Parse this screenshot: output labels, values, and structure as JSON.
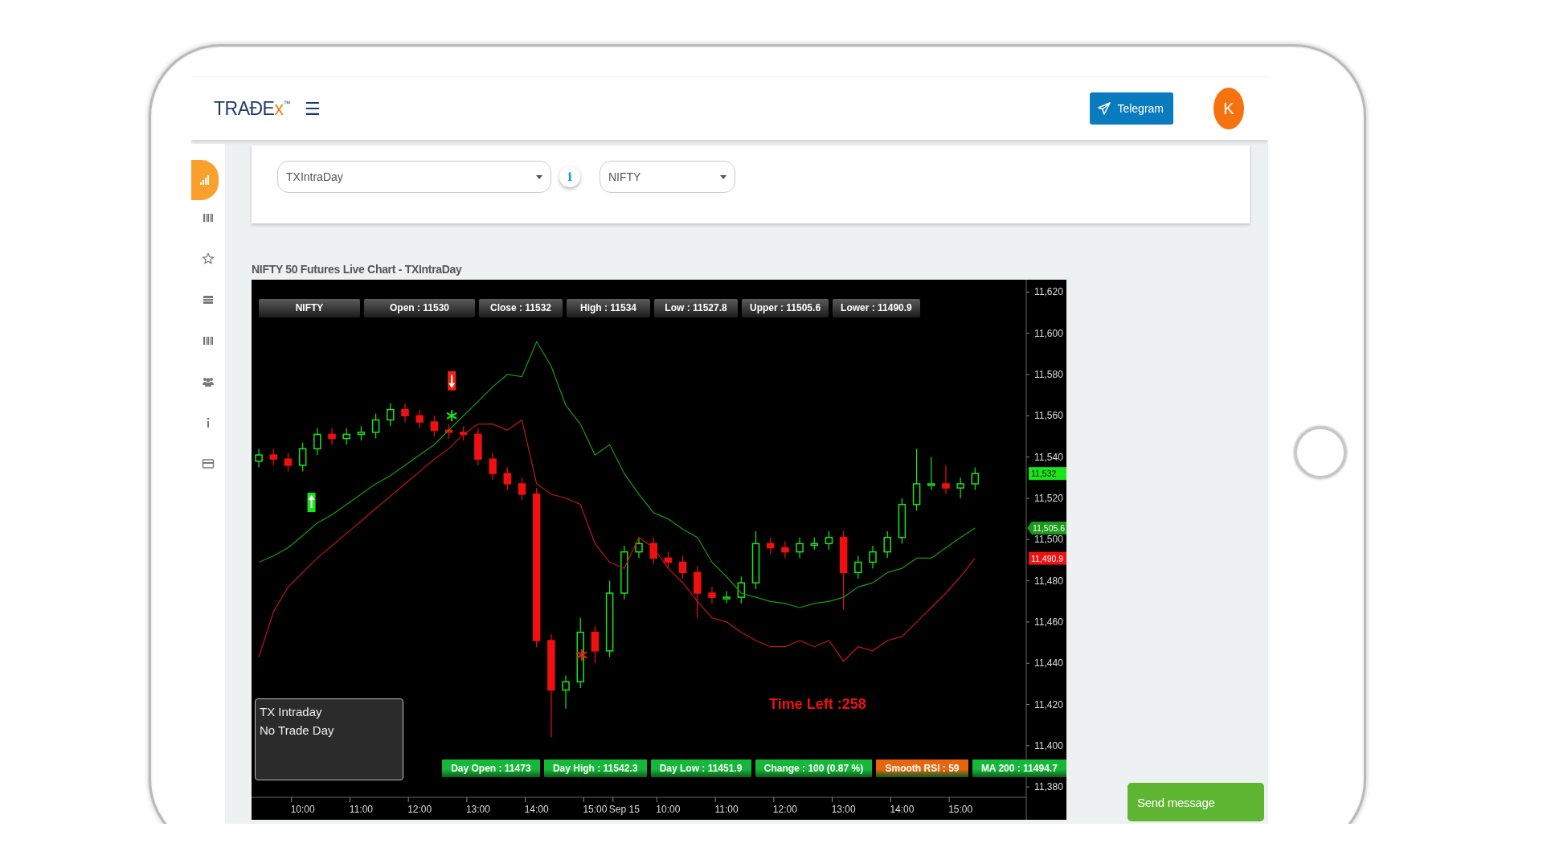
{
  "header": {
    "logo": {
      "text": "TRAĐE",
      "accent": "x",
      "mark": "™"
    },
    "menu_icon": "☰",
    "telegram_button": "Telegram",
    "avatar": "K"
  },
  "sidebar": {
    "items": [
      {
        "selected": true
      },
      {
        "selected": false
      },
      {
        "selected": false
      },
      {
        "selected": false
      },
      {
        "selected": false
      },
      {
        "selected": false
      },
      {
        "selected": false
      },
      {
        "selected": false
      }
    ]
  },
  "filters": {
    "strategy_select": {
      "value": "TXIntraDay"
    },
    "info_button": "i",
    "symbol_select": {
      "value": "NIFTY"
    }
  },
  "chart": {
    "title": "NIFTY 50 Futures Live Chart - TXIntraDay",
    "top_stats": [
      "NIFTY",
      "Open : 11530",
      "Close : 11532",
      "High : 11534",
      "Low : 11527.8",
      "Upper : 11505.6",
      "Lower : 11490.9"
    ],
    "legend": [
      "TX Intraday",
      "No Trade Day"
    ],
    "timer": "Time Left :258",
    "bottom_stats": [
      {
        "label": "Day Open : 11473",
        "color": "#16b83a"
      },
      {
        "label": "Day High : 11542.3",
        "color": "#16b83a"
      },
      {
        "label": "Day Low : 11451.9",
        "color": "#16b83a"
      },
      {
        "label": "Change : 100 (0.87 %)",
        "color": "#16b83a"
      },
      {
        "label": "Smooth RSI : 59",
        "color": "#e8650c"
      },
      {
        "label": "MA 200 : 11494.7",
        "color": "#16b83a"
      }
    ],
    "price_tags": [
      {
        "kind": "close",
        "label": "11,532",
        "color": "#19e619"
      },
      {
        "kind": "upper",
        "label": "11,505.6",
        "color": "#1a9a1a"
      },
      {
        "kind": "lower",
        "label": "11,490.9",
        "color": "#ee1111"
      }
    ],
    "chart_data": {
      "type": "candlestick",
      "ylim": [
        11375,
        11626
      ],
      "categories": [
        null,
        null,
        null,
        "10:00",
        null,
        null,
        null,
        "11:00",
        null,
        null,
        null,
        "12:00",
        null,
        null,
        null,
        "13:00",
        null,
        null,
        null,
        "14:00",
        null,
        null,
        null,
        "15:00",
        null,
        "Sep 15",
        null,
        null,
        "10:00",
        null,
        null,
        null,
        "11:00",
        null,
        null,
        null,
        "12:00",
        null,
        null,
        null,
        "13:00",
        null,
        null,
        null,
        "14:00",
        null,
        null,
        null,
        "15:00",
        null,
        null,
        null,
        null
      ],
      "yticks": [
        {
          "value": 11380,
          "label": "11,380"
        },
        {
          "value": 11400,
          "label": "11,400"
        },
        {
          "value": 11420,
          "label": "11,420"
        },
        {
          "value": 11440,
          "label": "11,440"
        },
        {
          "value": 11460,
          "label": "11,460"
        },
        {
          "value": 11480,
          "label": "11,480"
        },
        {
          "value": 11500,
          "label": "11,500"
        },
        {
          "value": 11520,
          "label": "11,520"
        },
        {
          "value": 11540,
          "label": "11,540"
        },
        {
          "value": 11560,
          "label": "11,560"
        },
        {
          "value": 11580,
          "label": "11,580"
        },
        {
          "value": 11600,
          "label": "11,600"
        },
        {
          "value": 11620,
          "label": "11,620"
        }
      ],
      "ohlc": [
        [
          11538,
          11544,
          11535,
          11541
        ],
        [
          11541,
          11544,
          11536,
          11539
        ],
        [
          11539,
          11542,
          11533,
          11536
        ],
        [
          11536,
          11547,
          11533,
          11544
        ],
        [
          11544,
          11554,
          11541,
          11551
        ],
        [
          11551,
          11554,
          11546,
          11549
        ],
        [
          11549,
          11554,
          11546,
          11551
        ],
        [
          11551,
          11555,
          11548,
          11552
        ],
        [
          11552,
          11561,
          11549,
          11558
        ],
        [
          11558,
          11566,
          11555,
          11563
        ],
        [
          11563,
          11566,
          11557,
          11560
        ],
        [
          11560,
          11563,
          11554,
          11557
        ],
        [
          11557,
          11560,
          11550,
          11553
        ],
        [
          11553,
          11556,
          11549,
          11552
        ],
        [
          11552,
          11555,
          11548,
          11551
        ],
        [
          11551,
          11554,
          11536,
          11539
        ],
        [
          11539,
          11542,
          11529,
          11532
        ],
        [
          11532,
          11535,
          11524,
          11527
        ],
        [
          11527,
          11530,
          11519,
          11522
        ],
        [
          11522,
          11525,
          11448,
          11451
        ],
        [
          11451,
          11454,
          11404,
          11427
        ],
        [
          11427,
          11434,
          11418,
          11431
        ],
        [
          11431,
          11462,
          11428,
          11455
        ],
        [
          11455,
          11458,
          11440,
          11446
        ],
        [
          11446,
          11480,
          11443,
          11474
        ],
        [
          11474,
          11497,
          11471,
          11494
        ],
        [
          11494,
          11501,
          11491,
          11498
        ],
        [
          11498,
          11501,
          11488,
          11491
        ],
        [
          11491,
          11494,
          11486,
          11489
        ],
        [
          11489,
          11492,
          11481,
          11484
        ],
        [
          11484,
          11487,
          11462,
          11474
        ],
        [
          11474,
          11477,
          11469,
          11472
        ],
        [
          11472,
          11475,
          11469,
          11472
        ],
        [
          11472,
          11482,
          11469,
          11479
        ],
        [
          11479,
          11504,
          11476,
          11498
        ],
        [
          11498,
          11501,
          11493,
          11496
        ],
        [
          11496,
          11499,
          11491,
          11494
        ],
        [
          11494,
          11501,
          11491,
          11498
        ],
        [
          11498,
          11501,
          11495,
          11498
        ],
        [
          11498,
          11504,
          11495,
          11501
        ],
        [
          11501,
          11504,
          11466,
          11484
        ],
        [
          11484,
          11492,
          11481,
          11489
        ],
        [
          11489,
          11497,
          11486,
          11494
        ],
        [
          11494,
          11504,
          11491,
          11501
        ],
        [
          11501,
          11520,
          11498,
          11517
        ],
        [
          11517,
          11544,
          11514,
          11527
        ],
        [
          11527,
          11540,
          11524,
          11527
        ],
        [
          11527,
          11536,
          11522,
          11525
        ],
        [
          11525,
          11530,
          11520,
          11527
        ],
        [
          11527,
          11535,
          11524,
          11532
        ],
        null,
        null,
        null
      ],
      "series": [
        {
          "type": "line",
          "color": "#1a9a1a",
          "values": [
            11489,
            11492,
            11496,
            11502,
            11508,
            11512,
            11517,
            11522,
            11527,
            11531,
            11536,
            11541,
            11546,
            11553,
            11560,
            11567,
            11574,
            11580,
            11579,
            11596,
            11584,
            11565,
            11556,
            11541,
            11546,
            11532,
            11522,
            11513,
            11510,
            11505,
            11501,
            11489,
            11482,
            11474,
            11472,
            11470,
            11469,
            11467,
            11469,
            11470,
            11472,
            11477,
            11479,
            11484,
            11486,
            11491,
            11491,
            11496,
            11501,
            11505.6,
            null,
            null,
            null
          ]
        },
        {
          "type": "line",
          "color": "#c01818",
          "values": [
            11443,
            11465,
            11477,
            11484,
            11491,
            11497,
            11503,
            11509,
            11515,
            11521,
            11527,
            11533,
            11539,
            11544,
            11551,
            11556,
            11556,
            11553,
            11558,
            11527,
            11522,
            11520,
            11517,
            11498,
            11489,
            11486,
            11501,
            11496,
            11486,
            11479,
            11470,
            11462,
            11460,
            11455,
            11451,
            11448,
            11448,
            11451,
            11448,
            11451,
            11441,
            11448,
            11446,
            11451,
            11453,
            11460,
            11467,
            11474,
            11482,
            11490.9,
            null,
            null,
            null
          ]
        }
      ]
    }
  },
  "send_message_button": "Send message"
}
